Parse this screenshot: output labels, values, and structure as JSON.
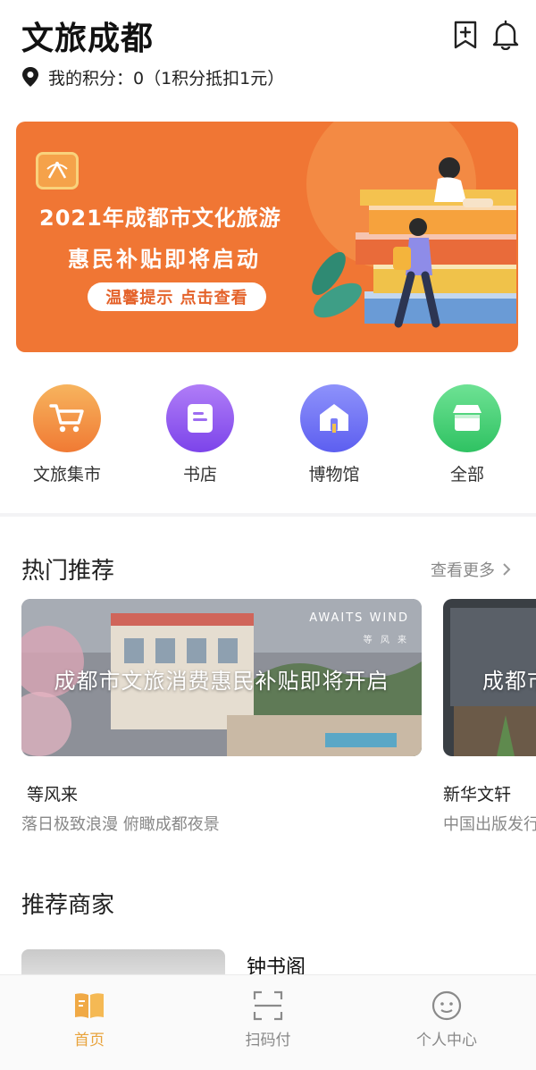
{
  "header": {
    "title": "文旅成都",
    "points_text": "我的积分：0（1积分抵扣1元）"
  },
  "banner": {
    "line1": "2021年成都市文化旅游",
    "line2": "惠民补贴即将启动",
    "tip": "温馨提示 点击查看"
  },
  "quick_entries": [
    {
      "label": "文旅集市",
      "icon": "cart-icon",
      "color": "#f39a3c"
    },
    {
      "label": "书店",
      "icon": "book-icon",
      "color": "#8f55f0"
    },
    {
      "label": "博物馆",
      "icon": "museum-icon",
      "color": "#6f74f5"
    },
    {
      "label": "全部",
      "icon": "shop-icon",
      "color": "#3fcd73"
    }
  ],
  "hot": {
    "title": "热门推荐",
    "more": "查看更多",
    "cards": [
      {
        "title": "等风来",
        "subtitle": "落日极致浪漫 俯瞰成都夜景",
        "caption": "成都市文旅消费惠民补贴即将开启",
        "brand": "AWAITS WIND",
        "brand_sub": "等 风 来"
      },
      {
        "title": "新华文轩",
        "subtitle": "中国出版发行",
        "caption": "成都市"
      }
    ]
  },
  "merchants": {
    "title": "推荐商家",
    "items": [
      {
        "name": "钟书阁"
      }
    ]
  },
  "tabbar": {
    "items": [
      {
        "label": "首页",
        "active": true
      },
      {
        "label": "扫码付",
        "active": false
      },
      {
        "label": "个人中心",
        "active": false
      }
    ],
    "active_color": "#e8a33c"
  }
}
